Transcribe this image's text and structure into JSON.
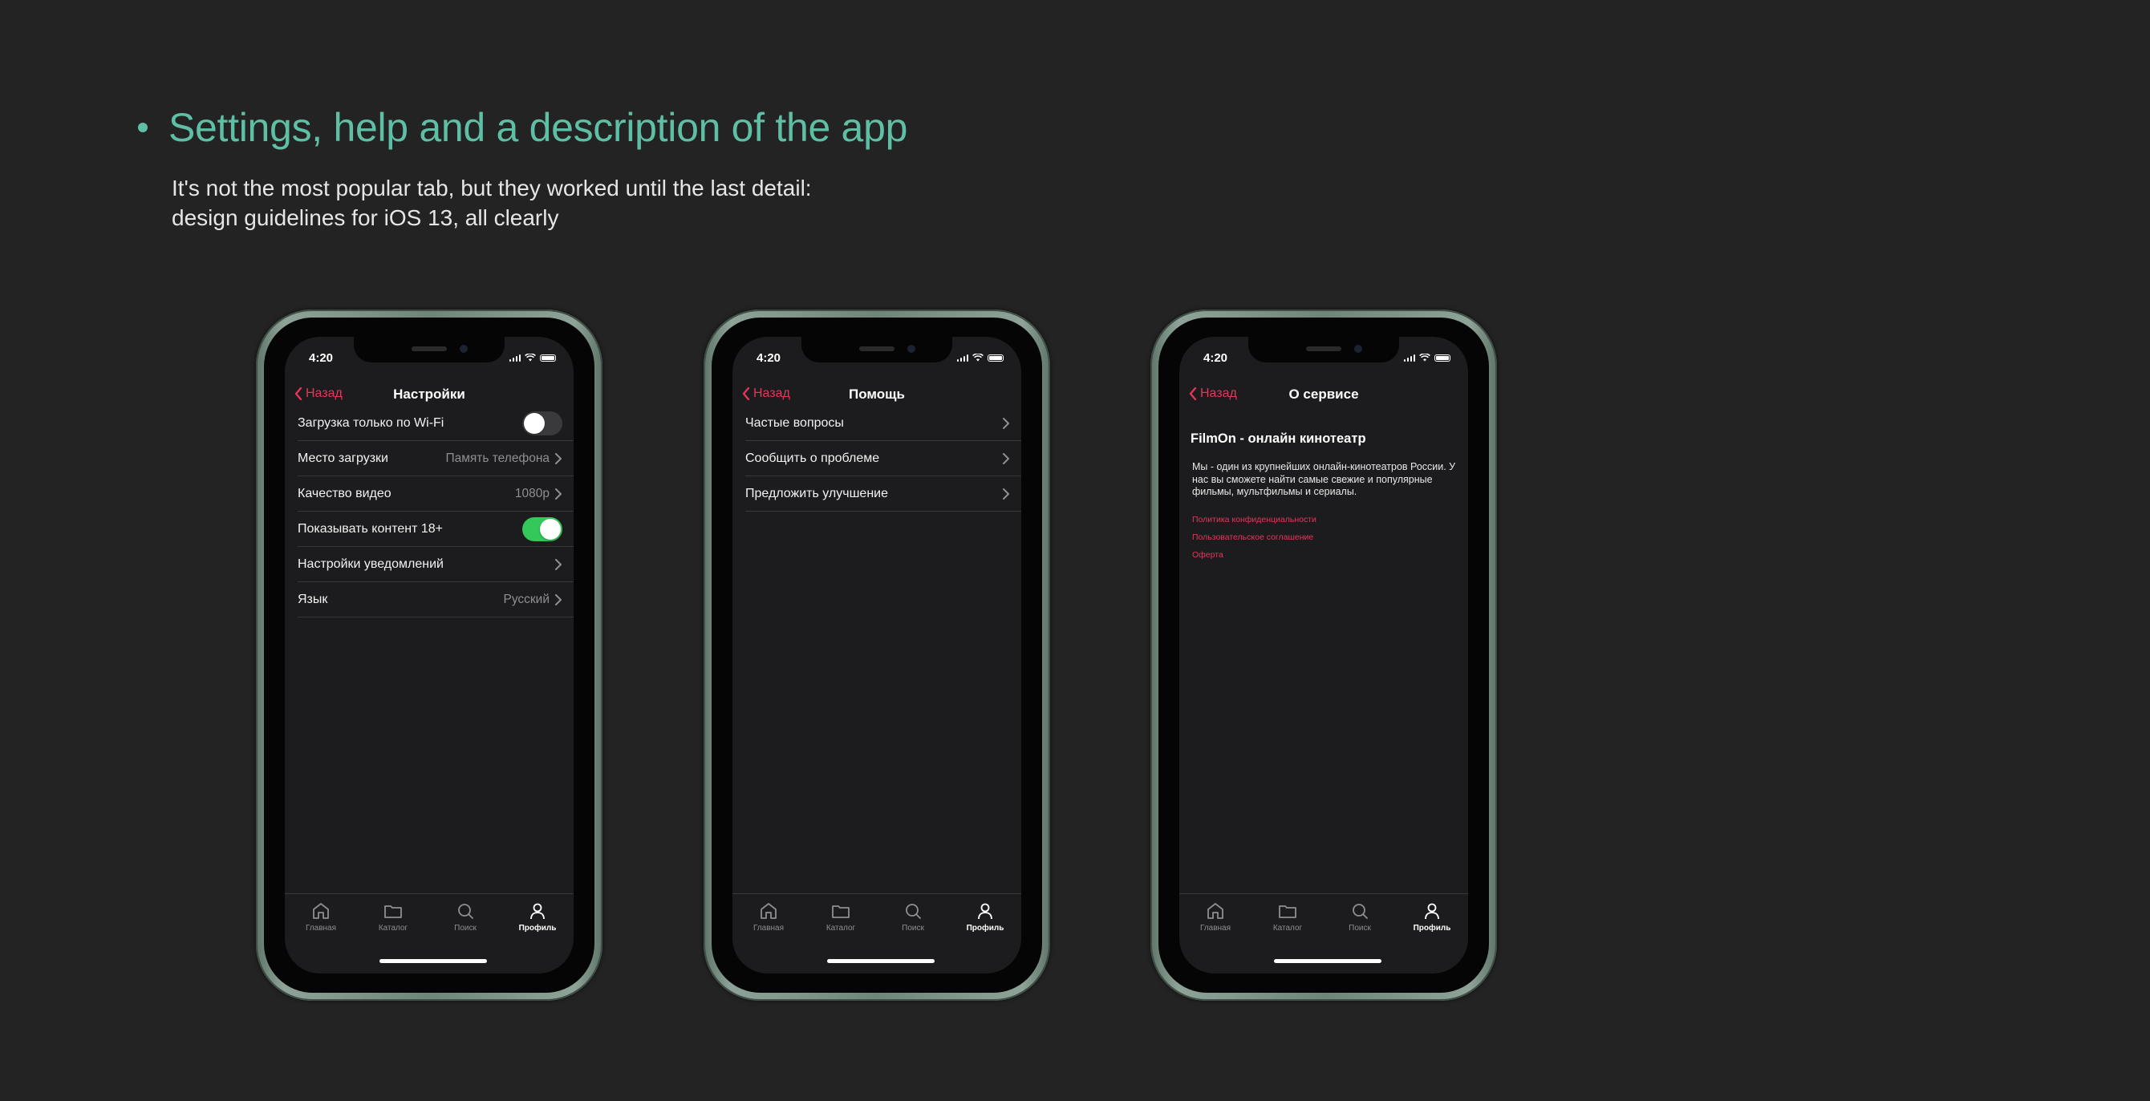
{
  "page": {
    "headline": "Settings, help and a description of the app",
    "subtitle_lines": [
      "It's not the most popular tab, but they worked until the last detail:",
      "design guidelines for iOS 13, all clearly"
    ]
  },
  "colors": {
    "accent_teal": "#5fbfa5",
    "accent_red": "#e5365a",
    "toggle_on": "#34c759",
    "screen_bg": "#1c1c1e"
  },
  "status": {
    "time": "4:20"
  },
  "tabbar": {
    "items": [
      {
        "label": "Главная",
        "icon": "home-icon"
      },
      {
        "label": "Каталог",
        "icon": "folder-icon"
      },
      {
        "label": "Поиск",
        "icon": "search-icon"
      },
      {
        "label": "Профиль",
        "icon": "profile-icon",
        "active": true
      }
    ]
  },
  "settings": {
    "back": "Назад",
    "title": "Настройки",
    "rows": [
      {
        "label": "Загрузка только по Wi-Fi",
        "toggle": "off"
      },
      {
        "label": "Место загрузки",
        "value": "Память телефона"
      },
      {
        "label": "Качество видео",
        "value": "1080p"
      },
      {
        "label": "Показывать контент 18+",
        "toggle": "on"
      },
      {
        "label": "Настройки уведомлений",
        "value": ""
      },
      {
        "label": "Язык",
        "value": "Русский"
      }
    ]
  },
  "help": {
    "back": "Назад",
    "title": "Помощь",
    "rows": [
      {
        "label": "Частые вопросы"
      },
      {
        "label": "Сообщить о проблеме"
      },
      {
        "label": "Предложить улучшение"
      }
    ]
  },
  "about": {
    "back": "Назад",
    "title": "О сервисе",
    "heading": "FilmOn - онлайн кинотеатр",
    "description": "Мы - один из крупнейших онлайн-кинотеатров России. У нас вы сможете найти самые свежие и популярные фильмы, мультфильмы и сериалы.",
    "links": [
      "Политика конфиденциальности",
      "Пользовательское соглашение",
      "Оферта"
    ]
  }
}
